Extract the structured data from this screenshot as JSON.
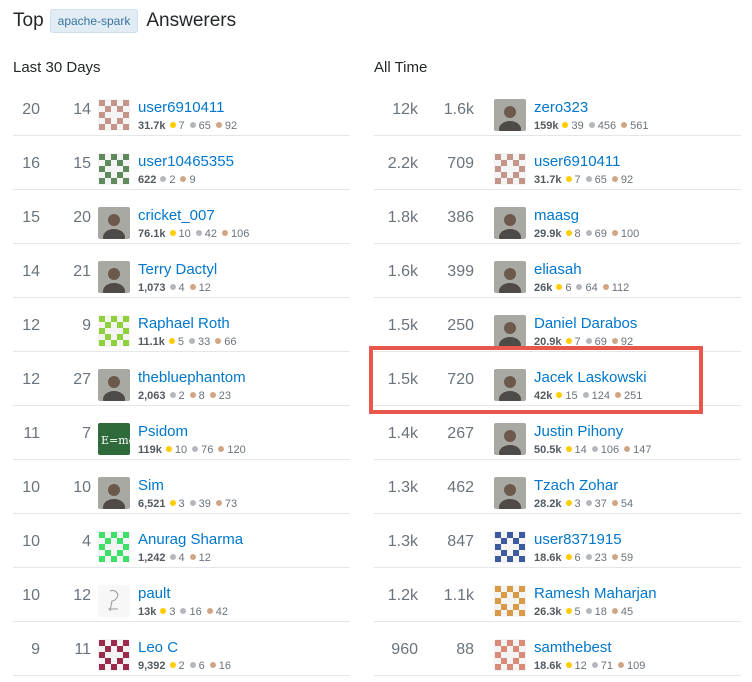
{
  "header": {
    "title_prefix": "Top",
    "tag": "apache-spark",
    "title_suffix": "Answerers"
  },
  "colors": {
    "link": "#0077cc",
    "highlight": "#e8574c",
    "tag_bg": "#e1ecf4"
  },
  "left": {
    "heading": "Last 30 Days",
    "rows": [
      {
        "a": "20",
        "b": "14",
        "name": "user6910411",
        "rep": "31.7k",
        "gold": "7",
        "silver": "65",
        "bronze": "92",
        "av": "id6910411"
      },
      {
        "a": "16",
        "b": "15",
        "name": "user10465355",
        "rep": "622",
        "silver": "2",
        "bronze": "9",
        "av": "idgreen"
      },
      {
        "a": "15",
        "b": "20",
        "name": "cricket_007",
        "rep": "76.1k",
        "gold": "10",
        "silver": "42",
        "bronze": "106",
        "av": "photo"
      },
      {
        "a": "14",
        "b": "21",
        "name": "Terry Dactyl",
        "rep": "1,073",
        "silver": "4",
        "bronze": "12",
        "av": "photo"
      },
      {
        "a": "12",
        "b": "9",
        "name": "Raphael Roth",
        "rep": "11.1k",
        "gold": "5",
        "silver": "33",
        "bronze": "66",
        "av": "idlime"
      },
      {
        "a": "12",
        "b": "27",
        "name": "thebluephantom",
        "rep": "2,063",
        "silver": "2",
        "bronze": "8",
        "extra": "23",
        "av": "photo"
      },
      {
        "a": "11",
        "b": "7",
        "name": "Psidom",
        "rep": "119k",
        "gold": "10",
        "silver": "76",
        "bronze": "120",
        "av": "chalk"
      },
      {
        "a": "10",
        "b": "10",
        "name": "Sim",
        "rep": "6,521",
        "gold": "3",
        "silver": "39",
        "bronze": "73",
        "av": "photo"
      },
      {
        "a": "10",
        "b": "4",
        "name": "Anurag Sharma",
        "rep": "1,242",
        "silver": "4",
        "bronze": "12",
        "av": "idbright"
      },
      {
        "a": "10",
        "b": "12",
        "name": "pault",
        "rep": "13k",
        "gold": "3",
        "silver": "16",
        "bronze": "42",
        "av": "sketch"
      },
      {
        "a": "9",
        "b": "11",
        "name": "Leo C",
        "rep": "9,392",
        "gold": "2",
        "silver": "6",
        "bronze": "16",
        "av": "idmaroon"
      }
    ]
  },
  "right": {
    "heading": "All Time",
    "rows": [
      {
        "a": "12k",
        "b": "1.6k",
        "name": "zero323",
        "rep": "159k",
        "gold": "39",
        "silver": "456",
        "bronze": "561",
        "av": "photo"
      },
      {
        "a": "2.2k",
        "b": "709",
        "name": "user6910411",
        "rep": "31.7k",
        "gold": "7",
        "silver": "65",
        "bronze": "92",
        "av": "id6910411"
      },
      {
        "a": "1.8k",
        "b": "386",
        "name": "maasg",
        "rep": "29.9k",
        "gold": "8",
        "silver": "69",
        "bronze": "100",
        "av": "photo"
      },
      {
        "a": "1.6k",
        "b": "399",
        "name": "eliasah",
        "rep": "26k",
        "gold": "6",
        "silver": "64",
        "bronze": "112",
        "av": "photo"
      },
      {
        "a": "1.5k",
        "b": "250",
        "name": "Daniel Darabos",
        "rep": "20.9k",
        "gold": "7",
        "silver": "69",
        "bronze": "92",
        "av": "photo"
      },
      {
        "a": "1.5k",
        "b": "720",
        "name": "Jacek Laskowski",
        "rep": "42k",
        "gold": "15",
        "silver": "124",
        "bronze": "251",
        "av": "photo"
      },
      {
        "a": "1.4k",
        "b": "267",
        "name": "Justin Pihony",
        "rep": "50.5k",
        "gold": "14",
        "silver": "106",
        "bronze": "147",
        "av": "photo"
      },
      {
        "a": "1.3k",
        "b": "462",
        "name": "Tzach Zohar",
        "rep": "28.2k",
        "gold": "3",
        "silver": "37",
        "bronze": "54",
        "av": "photo"
      },
      {
        "a": "1.3k",
        "b": "847",
        "name": "user8371915",
        "rep": "18.6k",
        "gold": "6",
        "silver": "23",
        "bronze": "59",
        "av": "idblue"
      },
      {
        "a": "1.2k",
        "b": "1.1k",
        "name": "Ramesh Maharjan",
        "rep": "26.3k",
        "gold": "5",
        "silver": "18",
        "bronze": "45",
        "av": "idorange"
      },
      {
        "a": "960",
        "b": "88",
        "name": "samthebest",
        "rep": "18.6k",
        "gold": "12",
        "silver": "71",
        "bronze": "109",
        "av": "idpink"
      }
    ]
  }
}
